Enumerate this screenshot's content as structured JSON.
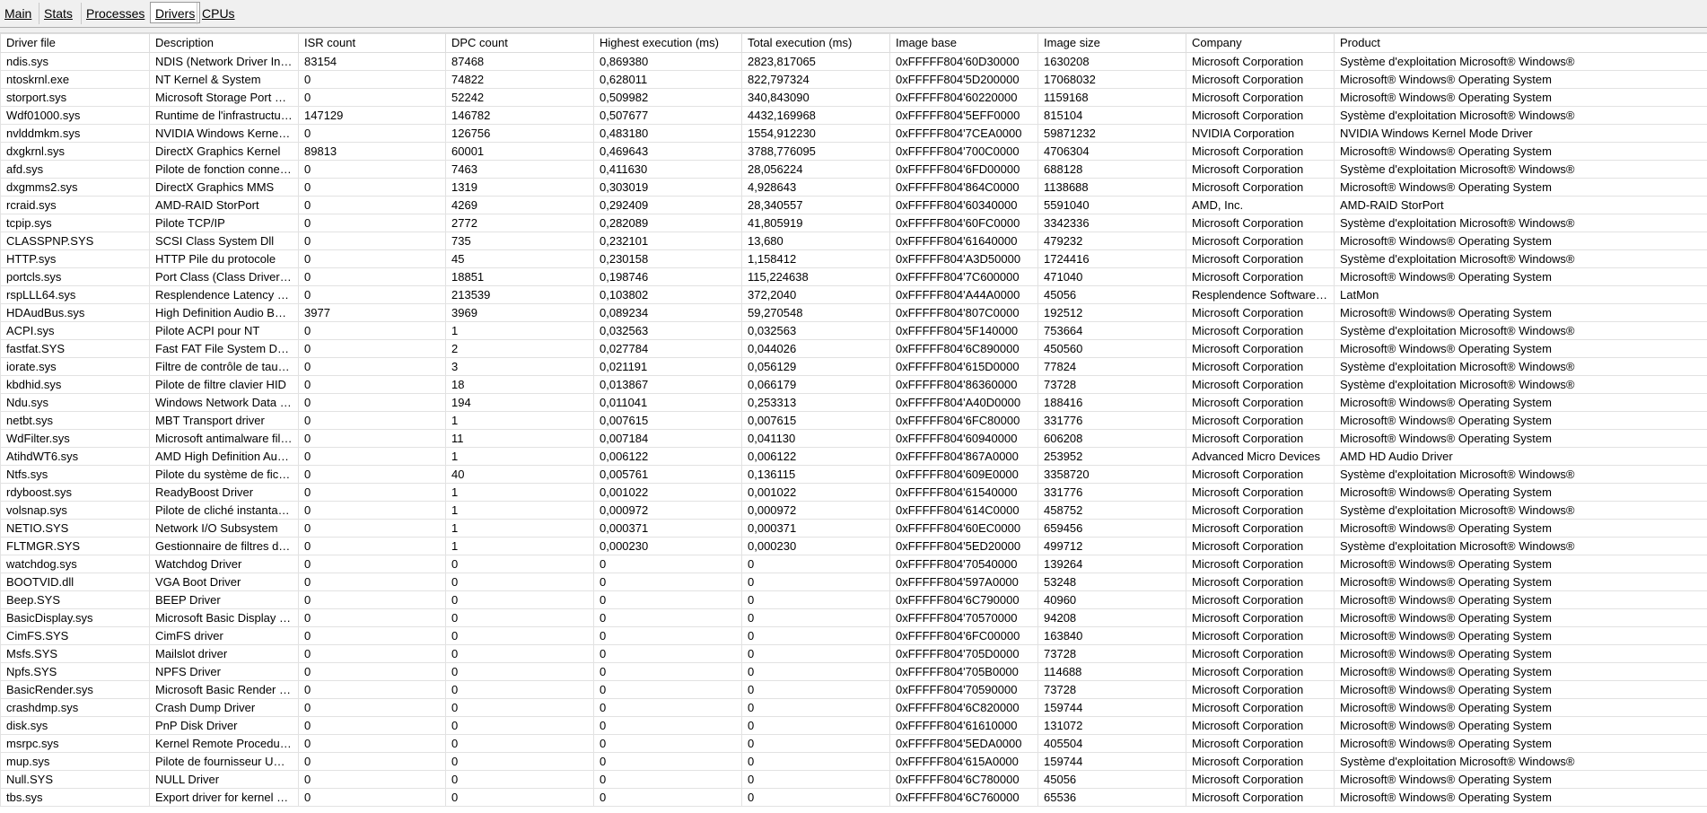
{
  "tabs": [
    {
      "label": "Main",
      "active": false
    },
    {
      "label": "Stats",
      "active": false
    },
    {
      "label": "Processes",
      "active": false
    },
    {
      "label": "Drivers",
      "active": true
    },
    {
      "label": "CPUs",
      "active": false
    }
  ],
  "columns": [
    "Driver file",
    "Description",
    "ISR count",
    "DPC count",
    "Highest execution (ms)",
    "Total execution (ms)",
    "Image base",
    "Image size",
    "Company",
    "Product"
  ],
  "rows": [
    [
      "ndis.sys",
      "NDIS (Network Driver Interface Specification)",
      "83154",
      "87468",
      "0,869380",
      "2823,817065",
      "0xFFFFF804'60D30000",
      "1630208",
      "Microsoft Corporation",
      "Système d'exploitation Microsoft® Windows®"
    ],
    [
      "ntoskrnl.exe",
      "NT Kernel & System",
      "0",
      "74822",
      "0,628011",
      "822,797324",
      "0xFFFFF804'5D200000",
      "17068032",
      "Microsoft Corporation",
      "Microsoft® Windows® Operating System"
    ],
    [
      "storport.sys",
      "Microsoft Storage Port Driver",
      "0",
      "52242",
      "0,509982",
      "340,843090",
      "0xFFFFF804'60220000",
      "1159168",
      "Microsoft Corporation",
      "Microsoft® Windows® Operating System"
    ],
    [
      "Wdf01000.sys",
      "Runtime de l'infrastructure de pilotes en mode noyau",
      "147129",
      "146782",
      "0,507677",
      "4432,169968",
      "0xFFFFF804'5EFF0000",
      "815104",
      "Microsoft Corporation",
      "Système d'exploitation Microsoft® Windows®"
    ],
    [
      "nvlddmkm.sys",
      "NVIDIA Windows Kernel Mode Driver",
      "0",
      "126756",
      "0,483180",
      "1554,912230",
      "0xFFFFF804'7CEA0000",
      "59871232",
      "NVIDIA Corporation",
      "NVIDIA Windows Kernel Mode Driver"
    ],
    [
      "dxgkrnl.sys",
      "DirectX Graphics Kernel",
      "89813",
      "60001",
      "0,469643",
      "3788,776095",
      "0xFFFFF804'700C0000",
      "4706304",
      "Microsoft Corporation",
      "Microsoft® Windows® Operating System"
    ],
    [
      "afd.sys",
      "Pilote de fonction connexe pour WinSock",
      "0",
      "7463",
      "0,411630",
      "28,056224",
      "0xFFFFF804'6FD00000",
      "688128",
      "Microsoft Corporation",
      "Système d'exploitation Microsoft® Windows®"
    ],
    [
      "dxgmms2.sys",
      "DirectX Graphics MMS",
      "0",
      "1319",
      "0,303019",
      "4,928643",
      "0xFFFFF804'864C0000",
      "1138688",
      "Microsoft Corporation",
      "Microsoft® Windows® Operating System"
    ],
    [
      "rcraid.sys",
      "AMD-RAID StorPort",
      "0",
      "4269",
      "0,292409",
      "28,340557",
      "0xFFFFF804'60340000",
      "5591040",
      "AMD, Inc.",
      "AMD-RAID StorPort"
    ],
    [
      "tcpip.sys",
      "Pilote TCP/IP",
      "0",
      "2772",
      "0,282089",
      "41,805919",
      "0xFFFFF804'60FC0000",
      "3342336",
      "Microsoft Corporation",
      "Système d'exploitation Microsoft® Windows®"
    ],
    [
      "CLASSPNP.SYS",
      "SCSI Class System Dll",
      "0",
      "735",
      "0,232101",
      "13,680",
      "0xFFFFF804'61640000",
      "479232",
      "Microsoft Corporation",
      "Microsoft® Windows® Operating System"
    ],
    [
      "HTTP.sys",
      "HTTP Pile du protocole",
      "0",
      "45",
      "0,230158",
      "1,158412",
      "0xFFFFF804'A3D50000",
      "1724416",
      "Microsoft Corporation",
      "Système d'exploitation Microsoft® Windows®"
    ],
    [
      "portcls.sys",
      "Port Class (Class Driver for Port/Miniport Devices)",
      "0",
      "18851",
      "0,198746",
      "115,224638",
      "0xFFFFF804'7C600000",
      "471040",
      "Microsoft Corporation",
      "Microsoft® Windows® Operating System"
    ],
    [
      "rspLLL64.sys",
      "Resplendence Latency Monitoring and Auxiliary Kernel Library",
      "0",
      "213539",
      "0,103802",
      "372,2040",
      "0xFFFFF804'A44A0000",
      "45056",
      "Resplendence Software Projects Sp.",
      "LatMon"
    ],
    [
      "HDAudBus.sys",
      "High Definition Audio Bus Driver",
      "3977",
      "3969",
      "0,089234",
      "59,270548",
      "0xFFFFF804'807C0000",
      "192512",
      "Microsoft Corporation",
      "Microsoft® Windows® Operating System"
    ],
    [
      "ACPI.sys",
      "Pilote ACPI pour NT",
      "0",
      "1",
      "0,032563",
      "0,032563",
      "0xFFFFF804'5F140000",
      "753664",
      "Microsoft Corporation",
      "Système d'exploitation Microsoft® Windows®"
    ],
    [
      "fastfat.SYS",
      "Fast FAT File System Driver",
      "0",
      "2",
      "0,027784",
      "0,044026",
      "0xFFFFF804'6C890000",
      "450560",
      "Microsoft Corporation",
      "Microsoft® Windows® Operating System"
    ],
    [
      "iorate.sys",
      "Filtre de contrôle de taux d'E/S",
      "0",
      "3",
      "0,021191",
      "0,056129",
      "0xFFFFF804'615D0000",
      "77824",
      "Microsoft Corporation",
      "Système d'exploitation Microsoft® Windows®"
    ],
    [
      "kbdhid.sys",
      "Pilote de filtre clavier HID",
      "0",
      "18",
      "0,013867",
      "0,066179",
      "0xFFFFF804'86360000",
      "73728",
      "Microsoft Corporation",
      "Système d'exploitation Microsoft® Windows®"
    ],
    [
      "Ndu.sys",
      "Windows Network Data Usage Monitoring Driver",
      "0",
      "194",
      "0,011041",
      "0,253313",
      "0xFFFFF804'A40D0000",
      "188416",
      "Microsoft Corporation",
      "Microsoft® Windows® Operating System"
    ],
    [
      "netbt.sys",
      "MBT Transport driver",
      "0",
      "1",
      "0,007615",
      "0,007615",
      "0xFFFFF804'6FC80000",
      "331776",
      "Microsoft Corporation",
      "Microsoft® Windows® Operating System"
    ],
    [
      "WdFilter.sys",
      "Microsoft antimalware file system filter driver",
      "0",
      "11",
      "0,007184",
      "0,041130",
      "0xFFFFF804'60940000",
      "606208",
      "Microsoft Corporation",
      "Microsoft® Windows® Operating System"
    ],
    [
      "AtihdWT6.sys",
      "AMD High Definition Audio Function Driver",
      "0",
      "1",
      "0,006122",
      "0,006122",
      "0xFFFFF804'867A0000",
      "253952",
      "Advanced Micro Devices",
      "AMD HD Audio Driver"
    ],
    [
      "Ntfs.sys",
      "Pilote du système de fichiers NT",
      "0",
      "40",
      "0,005761",
      "0,136115",
      "0xFFFFF804'609E0000",
      "3358720",
      "Microsoft Corporation",
      "Système d'exploitation Microsoft® Windows®"
    ],
    [
      "rdyboost.sys",
      "ReadyBoost Driver",
      "0",
      "1",
      "0,001022",
      "0,001022",
      "0xFFFFF804'61540000",
      "331776",
      "Microsoft Corporation",
      "Microsoft® Windows® Operating System"
    ],
    [
      "volsnap.sys",
      "Pilote de cliché instantané du volume",
      "0",
      "1",
      "0,000972",
      "0,000972",
      "0xFFFFF804'614C0000",
      "458752",
      "Microsoft Corporation",
      "Système d'exploitation Microsoft® Windows®"
    ],
    [
      "NETIO.SYS",
      "Network I/O Subsystem",
      "0",
      "1",
      "0,000371",
      "0,000371",
      "0xFFFFF804'60EC0000",
      "659456",
      "Microsoft Corporation",
      "Microsoft® Windows® Operating System"
    ],
    [
      "FLTMGR.SYS",
      "Gestionnaire de filtres de système de fichiers",
      "0",
      "1",
      "0,000230",
      "0,000230",
      "0xFFFFF804'5ED20000",
      "499712",
      "Microsoft Corporation",
      "Système d'exploitation Microsoft® Windows®"
    ],
    [
      "watchdog.sys",
      "Watchdog Driver",
      "0",
      "0",
      "0",
      "0",
      "0xFFFFF804'70540000",
      "139264",
      "Microsoft Corporation",
      "Microsoft® Windows® Operating System"
    ],
    [
      "BOOTVID.dll",
      "VGA Boot Driver",
      "0",
      "0",
      "0",
      "0",
      "0xFFFFF804'597A0000",
      "53248",
      "Microsoft Corporation",
      "Microsoft® Windows® Operating System"
    ],
    [
      "Beep.SYS",
      "BEEP Driver",
      "0",
      "0",
      "0",
      "0",
      "0xFFFFF804'6C790000",
      "40960",
      "Microsoft Corporation",
      "Microsoft® Windows® Operating System"
    ],
    [
      "BasicDisplay.sys",
      "Microsoft Basic Display Driver",
      "0",
      "0",
      "0",
      "0",
      "0xFFFFF804'70570000",
      "94208",
      "Microsoft Corporation",
      "Microsoft® Windows® Operating System"
    ],
    [
      "CimFS.SYS",
      "CimFS driver",
      "0",
      "0",
      "0",
      "0",
      "0xFFFFF804'6FC00000",
      "163840",
      "Microsoft Corporation",
      "Microsoft® Windows® Operating System"
    ],
    [
      "Msfs.SYS",
      "Mailslot driver",
      "0",
      "0",
      "0",
      "0",
      "0xFFFFF804'705D0000",
      "73728",
      "Microsoft Corporation",
      "Microsoft® Windows® Operating System"
    ],
    [
      "Npfs.SYS",
      "NPFS Driver",
      "0",
      "0",
      "0",
      "0",
      "0xFFFFF804'705B0000",
      "114688",
      "Microsoft Corporation",
      "Microsoft® Windows® Operating System"
    ],
    [
      "BasicRender.sys",
      "Microsoft Basic Render Driver",
      "0",
      "0",
      "0",
      "0",
      "0xFFFFF804'70590000",
      "73728",
      "Microsoft Corporation",
      "Microsoft® Windows® Operating System"
    ],
    [
      "crashdmp.sys",
      "Crash Dump Driver",
      "0",
      "0",
      "0",
      "0",
      "0xFFFFF804'6C820000",
      "159744",
      "Microsoft Corporation",
      "Microsoft® Windows® Operating System"
    ],
    [
      "disk.sys",
      "PnP Disk Driver",
      "0",
      "0",
      "0",
      "0",
      "0xFFFFF804'61610000",
      "131072",
      "Microsoft Corporation",
      "Microsoft® Windows® Operating System"
    ],
    [
      "msrpc.sys",
      "Kernel Remote Procedure Call Provider",
      "0",
      "0",
      "0",
      "0",
      "0xFFFFF804'5EDA0000",
      "405504",
      "Microsoft Corporation",
      "Microsoft® Windows® Operating System"
    ],
    [
      "mup.sys",
      "Pilote de fournisseur UNC multiple",
      "0",
      "0",
      "0",
      "0",
      "0xFFFFF804'615A0000",
      "159744",
      "Microsoft Corporation",
      "Système d'exploitation Microsoft® Windows®"
    ],
    [
      "Null.SYS",
      "NULL Driver",
      "0",
      "0",
      "0",
      "0",
      "0xFFFFF804'6C780000",
      "45056",
      "Microsoft Corporation",
      "Microsoft® Windows® Operating System"
    ],
    [
      "tbs.sys",
      "Export driver for kernel mode TPM API",
      "0",
      "0",
      "0",
      "0",
      "0xFFFFF804'6C760000",
      "65536",
      "Microsoft Corporation",
      "Microsoft® Windows® Operating System"
    ]
  ]
}
